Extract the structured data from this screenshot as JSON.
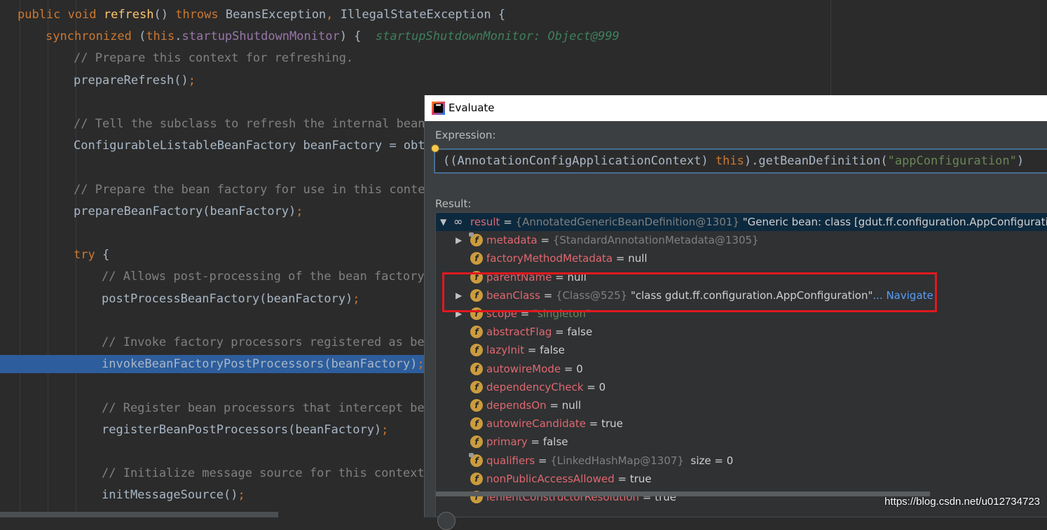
{
  "editor": {
    "lines": [
      {
        "indent": 0,
        "highlight": false,
        "tokens": [
          {
            "t": "public ",
            "c": "kw"
          },
          {
            "t": "void ",
            "c": "kw"
          },
          {
            "t": "refresh",
            "c": "fn"
          },
          {
            "t": "() ",
            "c": "pl"
          },
          {
            "t": "throws ",
            "c": "kw"
          },
          {
            "t": "BeansException",
            "c": "pl"
          },
          {
            "t": ", ",
            "c": "punc"
          },
          {
            "t": "IllegalStateException {",
            "c": "pl"
          }
        ]
      },
      {
        "indent": 1,
        "highlight": false,
        "tokens": [
          {
            "t": "synchronized ",
            "c": "kw"
          },
          {
            "t": "(",
            "c": "pl"
          },
          {
            "t": "this",
            "c": "kw"
          },
          {
            "t": ".",
            "c": "pl"
          },
          {
            "t": "startupShutdownMonitor",
            "c": "fld"
          },
          {
            "t": ") {  ",
            "c": "pl"
          },
          {
            "t": "startupShutdownMonitor: Object@999",
            "c": "inl"
          }
        ]
      },
      {
        "indent": 2,
        "highlight": false,
        "tokens": [
          {
            "t": "// Prepare this context for refreshing.",
            "c": "cm"
          }
        ]
      },
      {
        "indent": 2,
        "highlight": false,
        "tokens": [
          {
            "t": "prepareRefresh()",
            "c": "pl"
          },
          {
            "t": ";",
            "c": "punc"
          }
        ]
      },
      {
        "indent": 2,
        "highlight": false,
        "tokens": []
      },
      {
        "indent": 2,
        "highlight": false,
        "tokens": [
          {
            "t": "// Tell the subclass to refresh the internal bean",
            "c": "cm"
          }
        ]
      },
      {
        "indent": 2,
        "highlight": false,
        "tokens": [
          {
            "t": "ConfigurableListableBeanFactory beanFactory = obta",
            "c": "pl"
          }
        ]
      },
      {
        "indent": 2,
        "highlight": false,
        "tokens": []
      },
      {
        "indent": 2,
        "highlight": false,
        "tokens": [
          {
            "t": "// Prepare the bean factory for use in this contex",
            "c": "cm"
          }
        ]
      },
      {
        "indent": 2,
        "highlight": false,
        "tokens": [
          {
            "t": "prepareBeanFactory(beanFactory)",
            "c": "pl"
          },
          {
            "t": ";",
            "c": "punc"
          }
        ]
      },
      {
        "indent": 2,
        "highlight": false,
        "tokens": []
      },
      {
        "indent": 2,
        "highlight": false,
        "tokens": [
          {
            "t": "try ",
            "c": "kw"
          },
          {
            "t": "{",
            "c": "pl"
          }
        ]
      },
      {
        "indent": 3,
        "highlight": false,
        "tokens": [
          {
            "t": "// Allows post-processing of the bean factory",
            "c": "cm"
          }
        ]
      },
      {
        "indent": 3,
        "highlight": false,
        "tokens": [
          {
            "t": "postProcessBeanFactory(beanFactory)",
            "c": "pl"
          },
          {
            "t": ";",
            "c": "punc"
          }
        ]
      },
      {
        "indent": 3,
        "highlight": false,
        "tokens": []
      },
      {
        "indent": 3,
        "highlight": false,
        "tokens": [
          {
            "t": "// Invoke factory processors registered as bea",
            "c": "cm"
          }
        ]
      },
      {
        "indent": 3,
        "highlight": true,
        "tokens": [
          {
            "t": "invokeBeanFactoryPostProcessors(beanFactory)",
            "c": "pl"
          },
          {
            "t": ";",
            "c": "punc"
          }
        ]
      },
      {
        "indent": 3,
        "highlight": false,
        "tokens": []
      },
      {
        "indent": 3,
        "highlight": false,
        "tokens": [
          {
            "t": "// Register bean processors that intercept bea",
            "c": "cm"
          }
        ]
      },
      {
        "indent": 3,
        "highlight": false,
        "tokens": [
          {
            "t": "registerBeanPostProcessors(beanFactory)",
            "c": "pl"
          },
          {
            "t": ";",
            "c": "punc"
          }
        ]
      },
      {
        "indent": 3,
        "highlight": false,
        "tokens": []
      },
      {
        "indent": 3,
        "highlight": false,
        "tokens": [
          {
            "t": "// Initialize message source for this context.",
            "c": "cm"
          }
        ]
      },
      {
        "indent": 3,
        "highlight": false,
        "tokens": [
          {
            "t": "initMessageSource()",
            "c": "pl"
          },
          {
            "t": ";",
            "c": "punc"
          }
        ]
      }
    ]
  },
  "dialog": {
    "title": "Evaluate",
    "expression_label": "Expression:",
    "expression": [
      {
        "t": "((AnnotationConfigApplicationContext) ",
        "c": "pl"
      },
      {
        "t": "this",
        "c": "kw"
      },
      {
        "t": ").getBeanDefinition(",
        "c": "pl"
      },
      {
        "t": "\"appConfiguration\"",
        "c": "str"
      },
      {
        "t": ")",
        "c": "pl"
      }
    ],
    "result_label": "Result:",
    "result_rows": [
      {
        "level": 0,
        "toggle": "expanded",
        "icon": "watch",
        "name": "result",
        "eq": " = ",
        "ref": "{AnnotatedGenericBeanDefinition@1301}",
        "value": " \"Generic bean: class [gdut.ff.configuration.AppConfiguration]; s",
        "selected": true
      },
      {
        "level": 1,
        "toggle": "collapsed",
        "icon": "field-locked",
        "name": "metadata",
        "eq": " = ",
        "ref": "{StandardAnnotationMetadata@1305}",
        "value": ""
      },
      {
        "level": 1,
        "toggle": "none",
        "icon": "field",
        "name": "factoryMethodMetadata",
        "eq": " = ",
        "ref": "",
        "value": "null"
      },
      {
        "level": 1,
        "toggle": "none",
        "icon": "field",
        "name": "parentName",
        "eq": " = ",
        "ref": "",
        "value": "null"
      },
      {
        "level": 1,
        "toggle": "collapsed",
        "icon": "field",
        "name": "beanClass",
        "eq": " = ",
        "ref": "{Class@525}",
        "value": " \"class gdut.ff.configuration.AppConfiguration\"",
        "link": "... Navigate"
      },
      {
        "level": 1,
        "toggle": "collapsed",
        "icon": "field",
        "name": "scope",
        "eq": " = ",
        "ref": "",
        "value": "\"singleton\"",
        "scope": true
      },
      {
        "level": 1,
        "toggle": "none",
        "icon": "field",
        "name": "abstractFlag",
        "eq": " = ",
        "ref": "",
        "value": "false"
      },
      {
        "level": 1,
        "toggle": "none",
        "icon": "field",
        "name": "lazyInit",
        "eq": " = ",
        "ref": "",
        "value": "false"
      },
      {
        "level": 1,
        "toggle": "none",
        "icon": "field",
        "name": "autowireMode",
        "eq": " = ",
        "ref": "",
        "value": "0"
      },
      {
        "level": 1,
        "toggle": "none",
        "icon": "field",
        "name": "dependencyCheck",
        "eq": " = ",
        "ref": "",
        "value": "0"
      },
      {
        "level": 1,
        "toggle": "none",
        "icon": "field",
        "name": "dependsOn",
        "eq": " = ",
        "ref": "",
        "value": "null"
      },
      {
        "level": 1,
        "toggle": "none",
        "icon": "field",
        "name": "autowireCandidate",
        "eq": " = ",
        "ref": "",
        "value": "true"
      },
      {
        "level": 1,
        "toggle": "none",
        "icon": "field",
        "name": "primary",
        "eq": " = ",
        "ref": "",
        "value": "false"
      },
      {
        "level": 1,
        "toggle": "none",
        "icon": "field-locked",
        "name": "qualifiers",
        "eq": " = ",
        "ref": "{LinkedHashMap@1307}",
        "value": "  size = 0"
      },
      {
        "level": 1,
        "toggle": "none",
        "icon": "field",
        "name": "nonPublicAccessAllowed",
        "eq": " = ",
        "ref": "",
        "value": "true"
      },
      {
        "level": 1,
        "toggle": "none",
        "icon": "field",
        "name": "lenientConstructorResolution",
        "eq": " = ",
        "ref": "",
        "value": "true"
      }
    ]
  },
  "watermark": "https://blog.csdn.net/u012734723"
}
